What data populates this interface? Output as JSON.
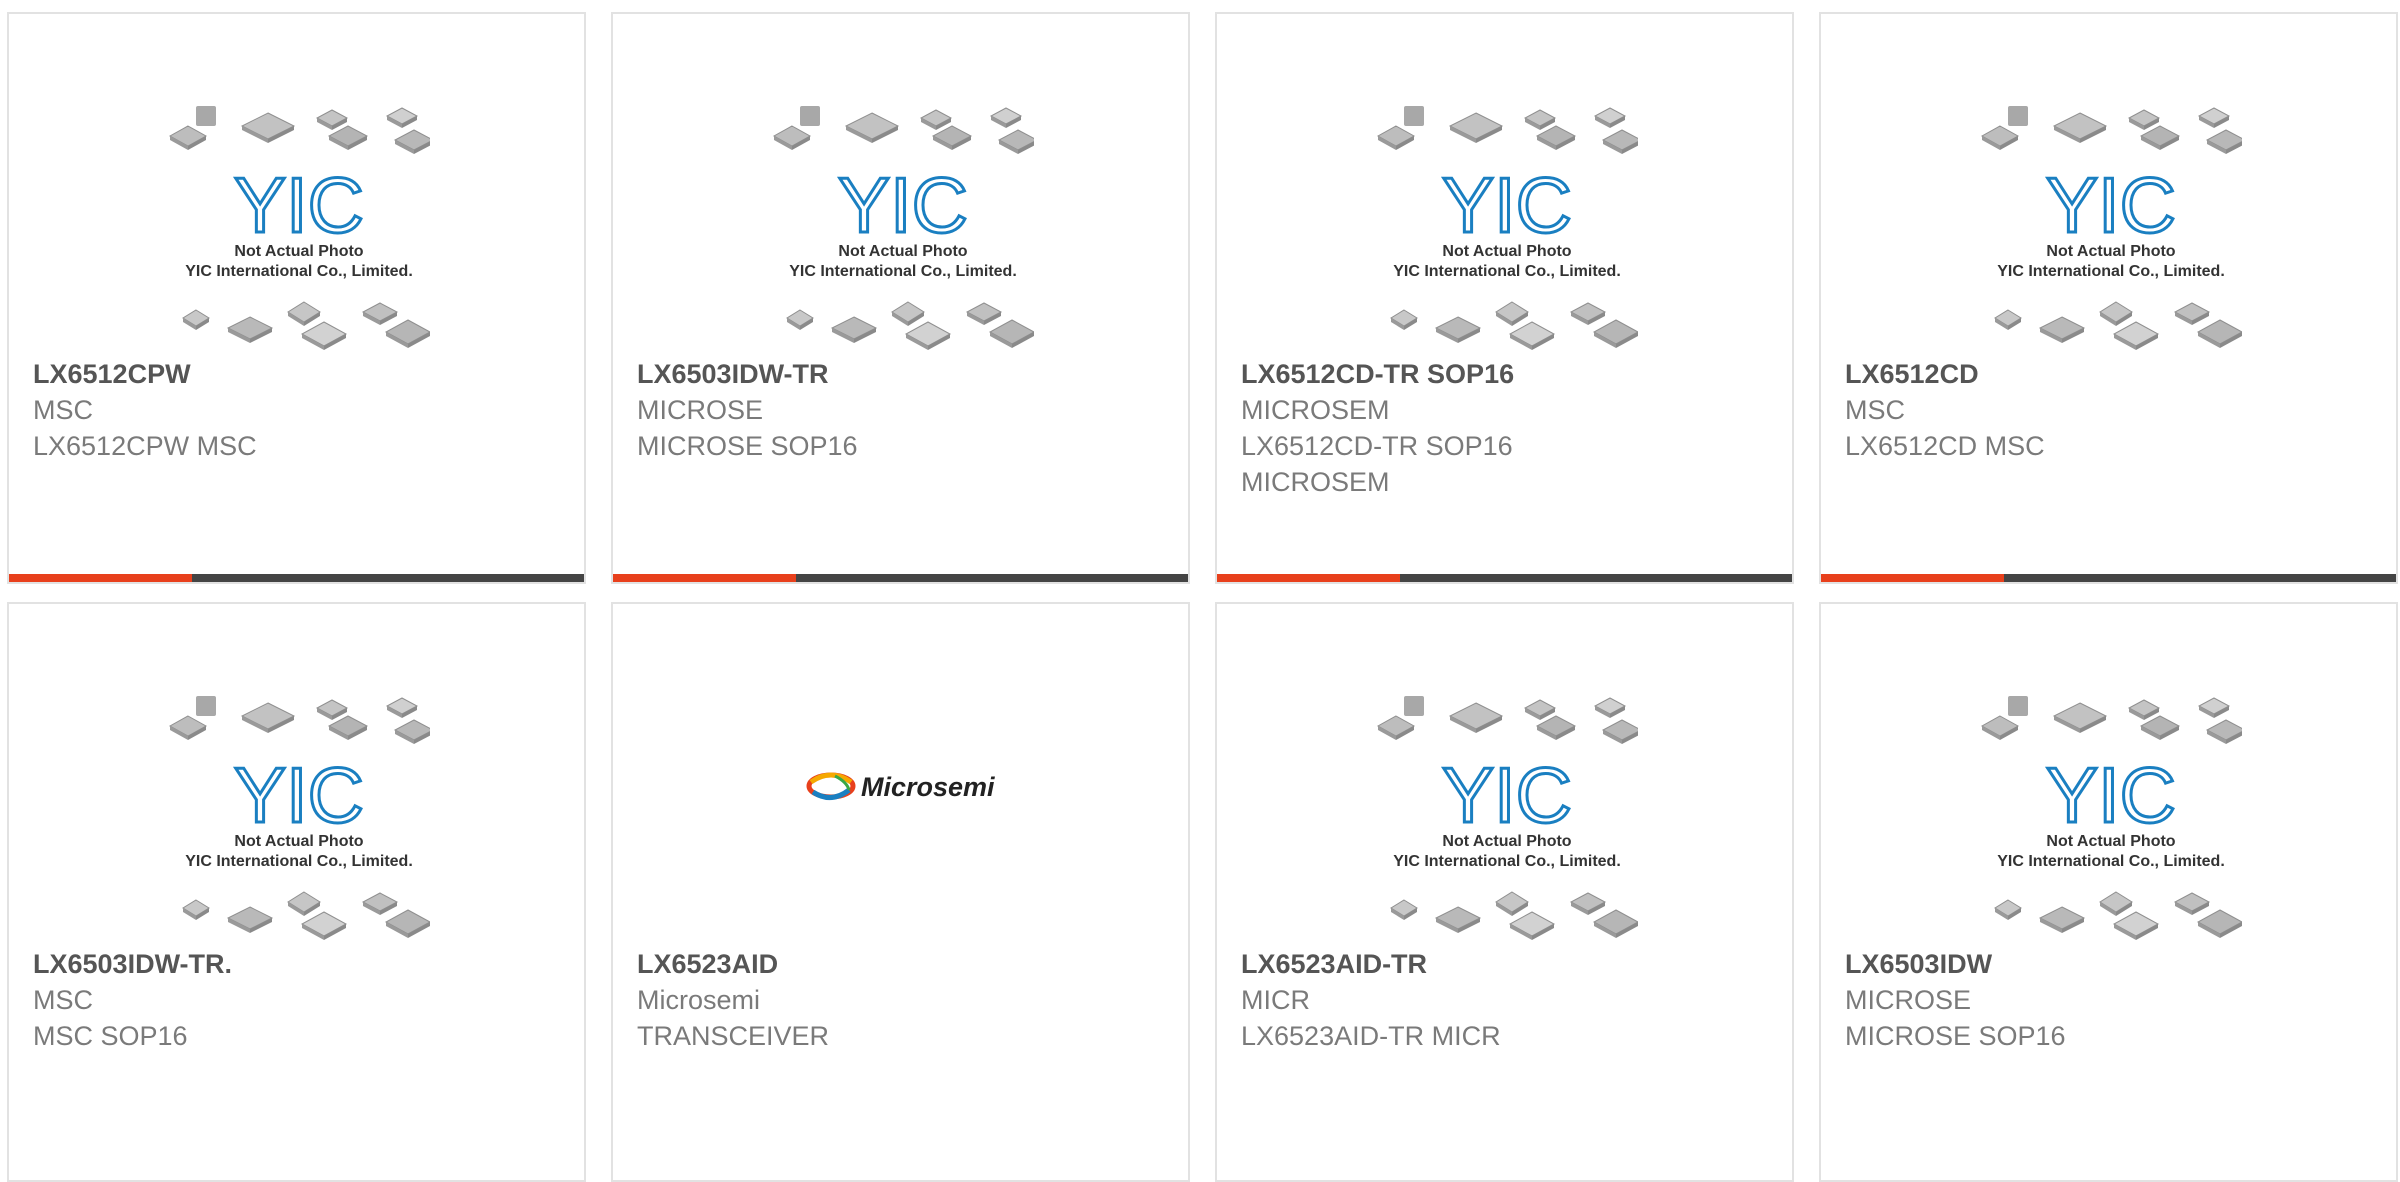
{
  "placeholder": {
    "line1": "Not Actual Photo",
    "line2": "YIC International Co., Limited.",
    "logo": "YIC"
  },
  "colors": {
    "accent_orange": "#e8401c",
    "bar_dark": "#444444",
    "yic_blue": "#1a7fc1"
  },
  "products": [
    {
      "part": "LX6512CPW",
      "brand": "MSC",
      "desc": "LX6512CPW MSC",
      "image": "placeholder"
    },
    {
      "part": "LX6503IDW-TR",
      "brand": "MICROSE",
      "desc": "MICROSE SOP16",
      "image": "placeholder"
    },
    {
      "part": "LX6512CD-TR SOP16",
      "brand": "MICROSEM",
      "desc": "LX6512CD-TR SOP16 MICROSEM",
      "image": "placeholder"
    },
    {
      "part": "LX6512CD",
      "brand": "MSC",
      "desc": "LX6512CD MSC",
      "image": "placeholder"
    },
    {
      "part": "LX6503IDW-TR.",
      "brand": "MSC",
      "desc": "MSC SOP16",
      "image": "placeholder"
    },
    {
      "part": "LX6523AID",
      "brand": "Microsemi",
      "desc": "TRANSCEIVER",
      "image": "microsemi-logo",
      "logo_text": "Microsemi"
    },
    {
      "part": "LX6523AID-TR",
      "brand": "MICR",
      "desc": "LX6523AID-TR MICR",
      "image": "placeholder"
    },
    {
      "part": "LX6503IDW",
      "brand": "MICROSE",
      "desc": "MICROSE SOP16",
      "image": "placeholder"
    }
  ]
}
